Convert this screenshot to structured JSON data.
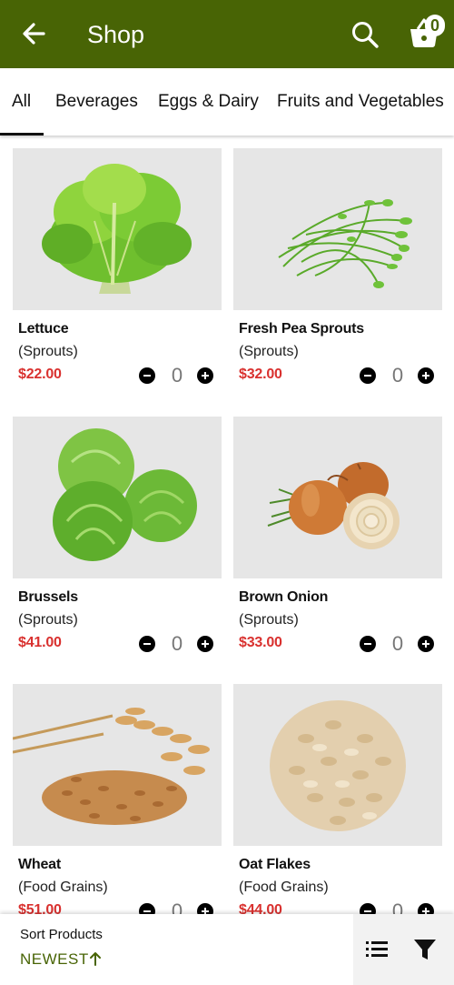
{
  "header": {
    "title": "Shop",
    "cart_count": "0",
    "background": "#486405",
    "icons": [
      "arrow-back-icon",
      "search-icon",
      "shopping-basket-icon"
    ]
  },
  "tabs": [
    {
      "label": "All",
      "active": true
    },
    {
      "label": "Beverages"
    },
    {
      "label": "Eggs & Dairy"
    },
    {
      "label": "Fruits and Vegetables"
    }
  ],
  "products": [
    {
      "name": "Lettuce",
      "category": "(Sprouts)",
      "price": "$22.00",
      "qty": "0",
      "image": "lettuce"
    },
    {
      "name": "Fresh Pea Sprouts",
      "category": "(Sprouts)",
      "price": "$32.00",
      "qty": "0",
      "image": "pea-sprouts"
    },
    {
      "name": "Brussels",
      "category": "(Sprouts)",
      "price": "$41.00",
      "qty": "0",
      "image": "brussels"
    },
    {
      "name": "Brown Onion",
      "category": "(Sprouts)",
      "price": "$33.00",
      "qty": "0",
      "image": "onion"
    },
    {
      "name": "Wheat",
      "category": "(Food Grains)",
      "price": "$51.00",
      "qty": "0",
      "image": "wheat"
    },
    {
      "name": "Oat Flakes",
      "category": "(Food Grains)",
      "price": "$44.00",
      "qty": "0",
      "image": "oat-flakes"
    }
  ],
  "sort": {
    "label": "Sort Products",
    "value": "NEWEST",
    "direction_icon": "arrow-up-icon"
  },
  "colors": {
    "accent": "#486405",
    "price": "#d9312f"
  }
}
